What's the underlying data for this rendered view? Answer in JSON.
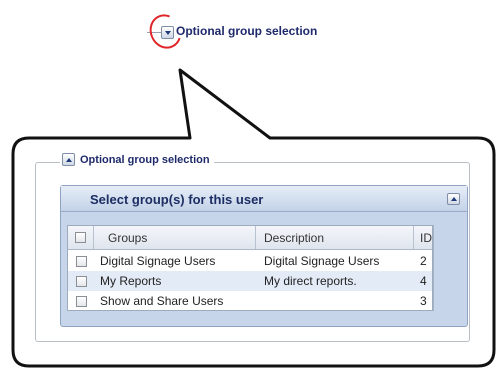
{
  "top_legend": {
    "label": "Optional group selection",
    "toggle_icon": "chevron-down-icon"
  },
  "fieldset": {
    "legend_label": "Optional group selection",
    "toggle_icon": "chevron-up-icon"
  },
  "panel": {
    "title": "Select group(s) for this user",
    "collapse_icon": "chevron-up-icon"
  },
  "grid": {
    "columns": [
      "Groups",
      "Description",
      "ID"
    ],
    "rows": [
      {
        "group": "Digital Signage Users",
        "description": "Digital Signage Users",
        "id": "2",
        "checked": false
      },
      {
        "group": "My Reports",
        "description": "My direct reports.",
        "id": "4",
        "checked": false
      },
      {
        "group": "Show and Share Users",
        "description": "",
        "id": "3",
        "checked": false
      }
    ]
  },
  "colors": {
    "annotation_red": "#e0262a",
    "legend_text": "#1f2a6b",
    "panel_blue": "#c6d5ea",
    "alt_row": "#e3ebf6"
  }
}
